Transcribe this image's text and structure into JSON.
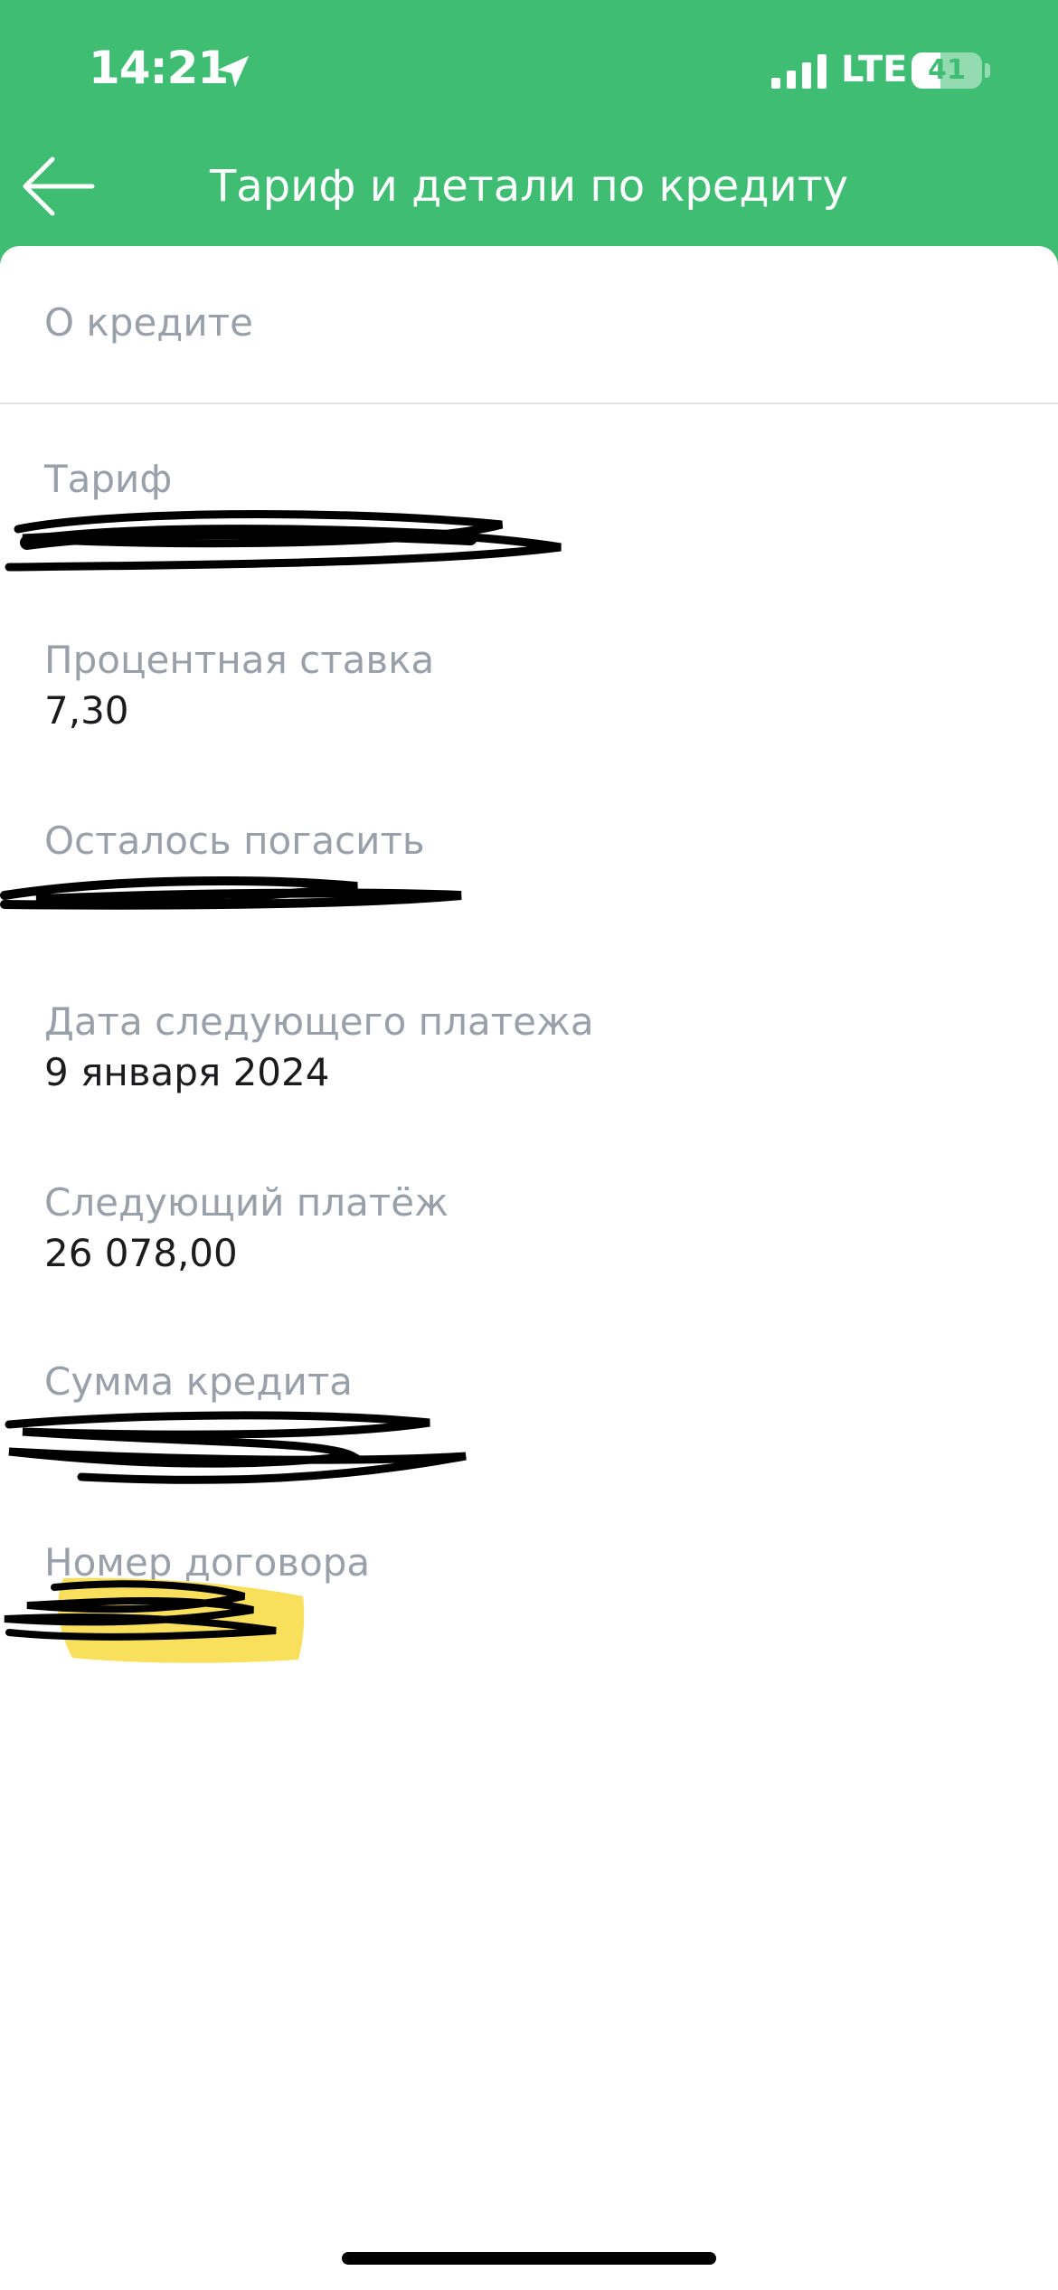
{
  "status_bar": {
    "time": "14:21",
    "network": "LTE",
    "battery_percent": "41",
    "battery_level": 0.41,
    "icons": [
      "location-arrow-icon",
      "signal-bars-icon",
      "battery-icon"
    ]
  },
  "nav": {
    "title": "Тариф и детали по кредиту",
    "back_icon": "arrow-left-icon"
  },
  "section_header": "О кредите",
  "fields": [
    {
      "label": "Тариф",
      "value": ""
    },
    {
      "label": "Процентная ставка",
      "value": "7,30"
    },
    {
      "label": "Осталось погасить",
      "value": ""
    },
    {
      "label": "Дата следующего платежа",
      "value": "9 января 2024"
    },
    {
      "label": "Следующий платёж",
      "value": "26 078,00"
    },
    {
      "label": "Сумма кредита",
      "value": ""
    },
    {
      "label": "Номер договора",
      "value": ""
    }
  ],
  "colors": {
    "brand_green": "#3fbd73",
    "label_gray": "#9aa0aa",
    "value_text": "#1c1c1e",
    "highlight_yellow": "#f7dc4a"
  }
}
